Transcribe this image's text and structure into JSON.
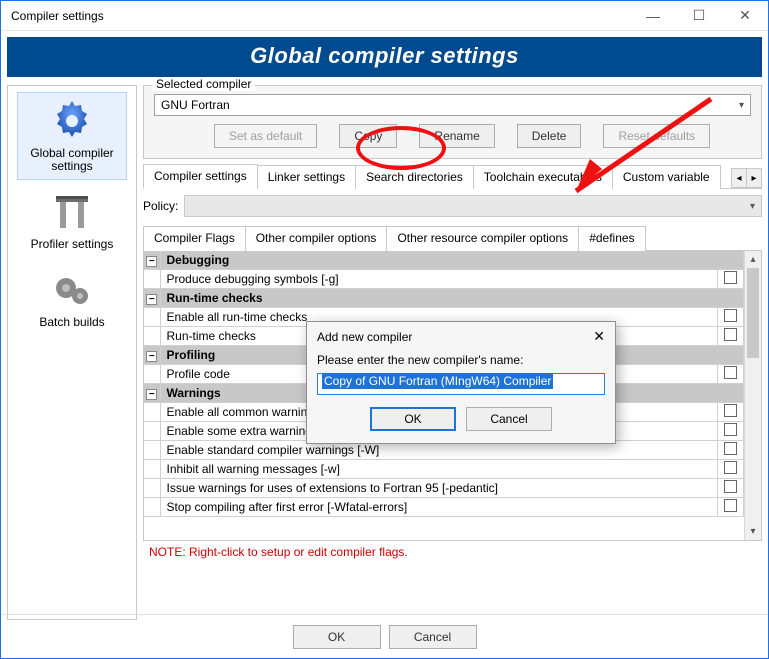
{
  "window": {
    "title": "Compiler settings"
  },
  "win_controls": {
    "min": "—",
    "max": "☐",
    "close": "✕"
  },
  "banner": "Global compiler settings",
  "sidebar": {
    "items": [
      {
        "label": "Global compiler settings"
      },
      {
        "label": "Profiler settings"
      },
      {
        "label": "Batch builds"
      }
    ]
  },
  "selected_compiler": {
    "group_title": "Selected compiler",
    "value": "GNU Fortran",
    "buttons": {
      "set_default": "Set as default",
      "copy": "Copy",
      "rename": "Rename",
      "delete": "Delete",
      "reset": "Reset defaults"
    }
  },
  "tabs": {
    "items": [
      "Compiler settings",
      "Linker settings",
      "Search directories",
      "Toolchain executables",
      "Custom variable"
    ],
    "arrows": {
      "left": "◂",
      "right": "▸"
    }
  },
  "policy": {
    "label": "Policy:"
  },
  "subtabs": {
    "items": [
      "Compiler Flags",
      "Other compiler options",
      "Other resource compiler options",
      "#defines"
    ]
  },
  "flags": {
    "rows": [
      {
        "type": "cat",
        "label": "Debugging"
      },
      {
        "type": "item",
        "label": "Produce debugging symbols  [-g]"
      },
      {
        "type": "cat",
        "label": "Run-time checks"
      },
      {
        "type": "item",
        "label": "Enable all run-time checks"
      },
      {
        "type": "item",
        "label": "Run-time checks"
      },
      {
        "type": "cat",
        "label": "Profiling"
      },
      {
        "type": "item",
        "label": "Profile code"
      },
      {
        "type": "cat",
        "label": "Warnings"
      },
      {
        "type": "item",
        "label": "Enable all common warnings"
      },
      {
        "type": "item",
        "label": "Enable some extra warning flags  [-Wextra]"
      },
      {
        "type": "item",
        "label": "Enable standard compiler warnings  [-W]"
      },
      {
        "type": "item",
        "label": "Inhibit all warning messages  [-w]"
      },
      {
        "type": "item",
        "label": "Issue warnings for uses of extensions to Fortran 95  [-pedantic]"
      },
      {
        "type": "item",
        "label": "Stop compiling after first error  [-Wfatal-errors]"
      }
    ],
    "expander_glyph": "⊟"
  },
  "note": "NOTE: Right-click to setup or edit compiler flags.",
  "footer": {
    "ok": "OK",
    "cancel": "Cancel"
  },
  "modal": {
    "title": "Add new compiler",
    "msg": "Please enter the new compiler's name:",
    "input_value": "Copy of GNU Fortran (MIngW64) Compiler",
    "ok": "OK",
    "cancel": "Cancel",
    "close_glyph": "✕"
  }
}
